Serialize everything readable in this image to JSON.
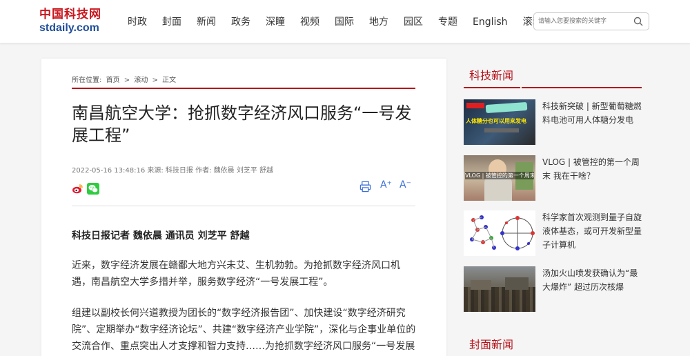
{
  "header": {
    "logo_cn": "中国科技网",
    "logo_en": "stdaily.com",
    "nav": [
      "时政",
      "封面",
      "新闻",
      "政务",
      "深瞳",
      "视频",
      "国际",
      "地方",
      "园区",
      "专题",
      "English",
      "滚动"
    ],
    "search_placeholder": "请输入您要搜索的关键字",
    "search_icon": "search-icon"
  },
  "breadcrumb": {
    "label": "所在位置:",
    "items": [
      "首页",
      "滚动",
      "正文"
    ],
    "separator": ">"
  },
  "article": {
    "title": "南昌航空大学：抢抓数字经济风口服务“一号发展工程”",
    "meta": "2022-05-16 13:48:16 来源: 科技日报 作者: 魏依晨 刘芝平 舒越",
    "tools": {
      "print_icon": "printer-icon",
      "font_up_label": "A⁺",
      "font_down_label": "A⁻"
    },
    "byline": "科技日报记者 魏依晨 通讯员 刘芝平 舒越",
    "paragraphs": [
      "近来，数字经济发展在赣鄱大地方兴未艾、生机勃勃。为抢抓数字经济风口机遇，南昌航空大学多措并举，服务数字经济“一号发展工程”。",
      "组建以副校长何兴道教授为团长的“数字经济报告团”、加快建设“数字经济研究院”、定期举办“数字经济论坛”、共建“数字经济产业学院”，深化与企事业单位的交流合作、重点突出人才支撑和智力支持……为抢抓数字经济风口服务“一号发展工程”，"
    ]
  },
  "sidebar": {
    "section1_title": "科技新闻",
    "news": [
      {
        "text": "科技新突破 | 新型葡萄糖燃料电池可用人体糖分发电",
        "thumb_caption": "人体糖分也可以用来发电"
      },
      {
        "text": "VLOG | 被管控的第一个周末 我在干啥？",
        "thumb_caption": "VLOG | 被管控的第一个周末我在干啥"
      },
      {
        "text": "科学家首次观测到量子自旋液体基态，或可开发新型量子计算机",
        "thumb_caption": ""
      },
      {
        "text": "汤加火山喷发获确认为“最大爆炸” 超过历次核爆",
        "thumb_caption": ""
      }
    ],
    "section2_title": "封面新闻"
  },
  "colors": {
    "accent_red": "#b5121b",
    "logo_blue": "#1f4e9a",
    "tool_blue": "#3a6fd8"
  }
}
